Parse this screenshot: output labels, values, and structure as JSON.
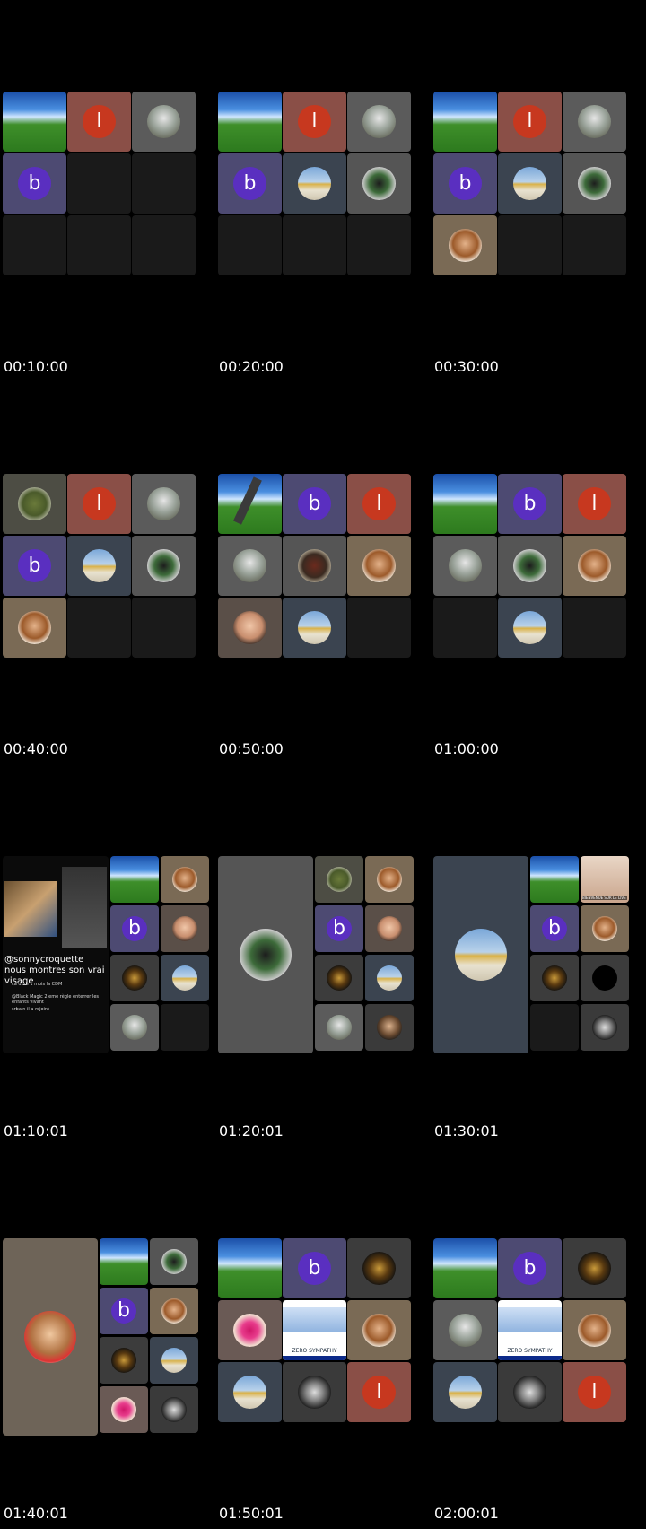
{
  "title": "",
  "timestamps": [
    "00:10:00",
    "00:20:00",
    "00:30:00",
    "00:40:00",
    "00:50:00",
    "01:00:00",
    "01:10:01",
    "01:20:01",
    "01:30:01",
    "01:40:01",
    "01:50:01",
    "02:00:01"
  ],
  "avatar_letters": {
    "l": "l",
    "b": "b"
  },
  "overlay_text": {
    "caption": "@sonnycroquette nous montres son vrai visage",
    "comments": [
      "ça dure 1 mois la CDM",
      "@Black Magic 2 eme règle enterrer les enfants vivant",
      "srbain il a rejoint"
    ],
    "banner": "ZERO SYMPATHY",
    "subtitle": "BIENVENUE SUR LE LIVE"
  },
  "colors": {
    "bg": "#000000",
    "tile_empty": "#1a1a1a",
    "tile_l": "#8a4f47",
    "tile_b": "#4d4a72",
    "circle_l": "#c7381f",
    "circle_b": "#5a2fc0"
  }
}
